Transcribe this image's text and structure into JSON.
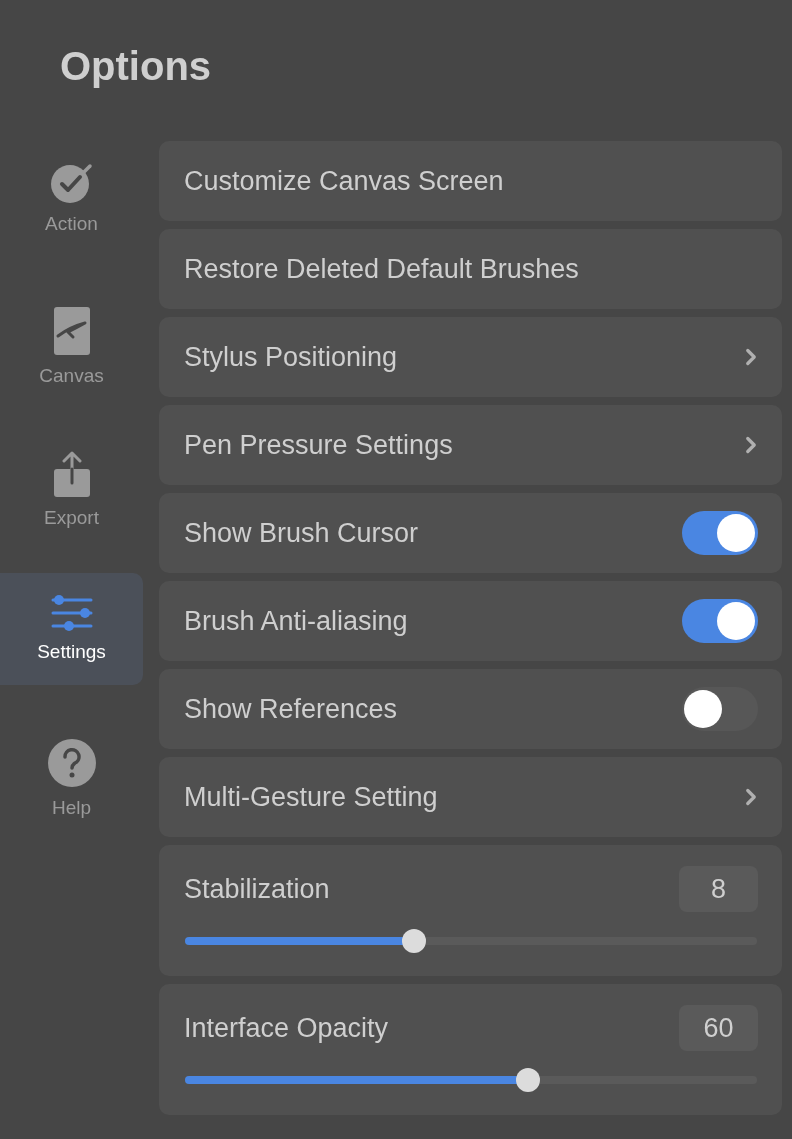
{
  "title": "Options",
  "sidebar": {
    "items": [
      {
        "kind": "action",
        "label": "Action",
        "selected": false
      },
      {
        "kind": "canvas",
        "label": "Canvas",
        "selected": false
      },
      {
        "kind": "export",
        "label": "Export",
        "selected": false
      },
      {
        "kind": "settings",
        "label": "Settings",
        "selected": true
      },
      {
        "kind": "help",
        "label": "Help",
        "selected": false
      }
    ]
  },
  "options": [
    {
      "kind": "action",
      "label": "Customize Canvas Screen"
    },
    {
      "kind": "action",
      "label": "Restore Deleted Default Brushes"
    },
    {
      "kind": "submenu",
      "label": "Stylus Positioning"
    },
    {
      "kind": "submenu",
      "label": "Pen Pressure Settings"
    },
    {
      "kind": "toggle",
      "label": "Show Brush Cursor",
      "on": true
    },
    {
      "kind": "toggle",
      "label": "Brush Anti-aliasing",
      "on": true
    },
    {
      "kind": "toggle",
      "label": "Show References",
      "on": false
    },
    {
      "kind": "submenu",
      "label": "Multi-Gesture Setting"
    },
    {
      "kind": "slider",
      "label": "Stabilization",
      "value": "8",
      "level": 0.4
    },
    {
      "kind": "slider",
      "label": "Interface Opacity",
      "value": "60",
      "level": 0.6
    }
  ]
}
